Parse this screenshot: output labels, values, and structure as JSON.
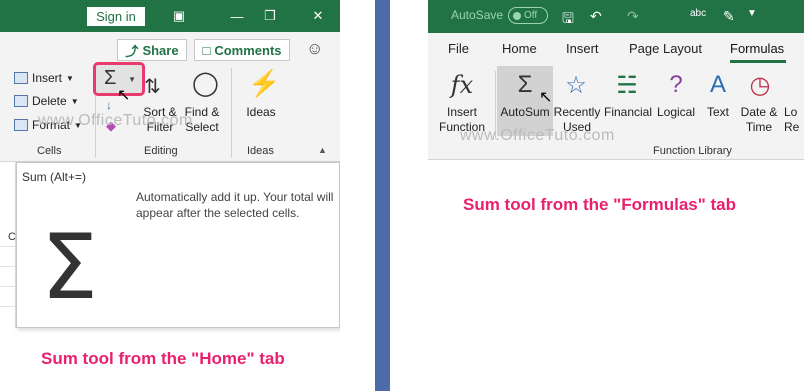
{
  "left": {
    "titlebar": {
      "signin": "Sign in"
    },
    "ribbon": {
      "share": "Share",
      "comments": "Comments",
      "insert": "Insert",
      "delete": "Delete",
      "format": "Format",
      "cells_group": "Cells",
      "editing_group": "Editing",
      "ideas_group": "Ideas",
      "sort_filter": "Sort &\nFilter",
      "find_select": "Find &\nSelect",
      "ideas": "Ideas"
    },
    "tooltip": {
      "title": "Sum (Alt+=)",
      "desc": "Automatically add it up. Your total will appear after the selected cells."
    },
    "caption": "Sum tool from the \"Home\" tab",
    "watermark": "www.OfficeTuto.com"
  },
  "right": {
    "titlebar": {
      "autosave": "AutoSave",
      "toggle": "Off"
    },
    "tabs": [
      "File",
      "Home",
      "Insert",
      "Page Layout",
      "Formulas"
    ],
    "ribbon": {
      "insert_function": "Insert\nFunction",
      "autosum": "AutoSum",
      "recently_used": "Recently\nUsed",
      "financial": "Financial",
      "logical": "Logical",
      "text": "Text",
      "date_time": "Date &\nTime",
      "lookup": "Lo\nRe",
      "group": "Function Library"
    },
    "caption": "Sum tool from the \"Formulas\" tab",
    "watermark": "www.OfficeTuto.com"
  },
  "colors": {
    "excel_green": "#217346",
    "highlight": "#e83a6d",
    "caption": "#e8206e",
    "divider": "#4d6ba8"
  }
}
